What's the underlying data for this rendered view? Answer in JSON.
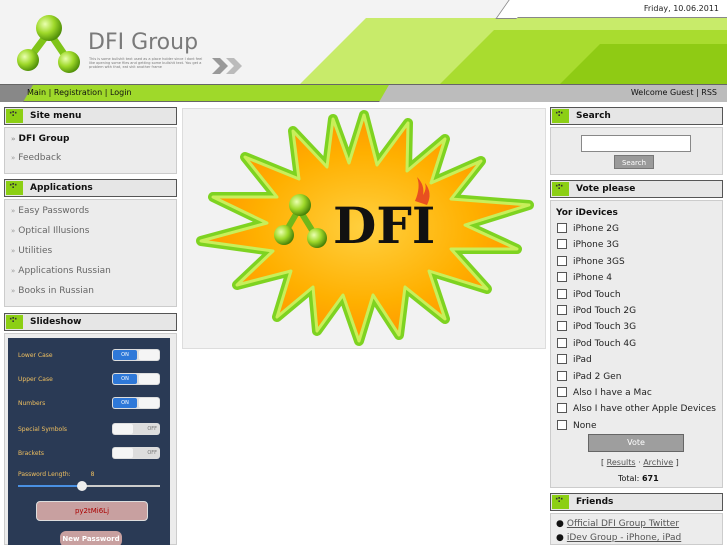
{
  "header": {
    "date": "Friday, 10.06.2011",
    "brand": "DFI Group",
    "tagline": "This is some bullshit text used as a place holder since I dont feel like opening some files and getting some bullshit text. You get a problem with that, eat shit another frame"
  },
  "nav": {
    "main": "Main",
    "registration": "Registration",
    "login": "Login",
    "sep": "|",
    "welcome": "Welcome Guest",
    "rss": "RSS"
  },
  "site_menu": {
    "title": "Site menu",
    "items": [
      "DFI Group",
      "Feedback"
    ]
  },
  "applications": {
    "title": "Applications",
    "items": [
      "Easy Passwords",
      "Optical Illusions",
      "Utilities",
      "Applications Russian",
      "Books in Russian"
    ]
  },
  "slideshow": {
    "title": "Slideshow",
    "rows": [
      "Lower Case",
      "Upper Case",
      "Numbers",
      "Special Symbols",
      "Brackets"
    ],
    "states": [
      "ON",
      "ON",
      "ON",
      "OFF",
      "OFF"
    ],
    "length_label": "Password Length:",
    "length_value": "8",
    "length_fraction": 0.45,
    "generated": "py2tMi6Lj",
    "new_button": "New Password"
  },
  "center_logo": "DFI",
  "search": {
    "title": "Search",
    "button": "Search",
    "placeholder": ""
  },
  "vote": {
    "title": "Vote please",
    "question": "Yor iDevices",
    "options": [
      "iPhone 2G",
      "iPhone 3G",
      "iPhone 3GS",
      "iPhone 4",
      "iPod Touch",
      "iPod Touch 2G",
      "iPod Touch 3G",
      "iPod Touch 4G",
      "iPad",
      "iPad 2 Gen",
      "Also I have a Mac",
      "Also I have other Apple Devices",
      "None"
    ],
    "button": "Vote",
    "results": "Results",
    "archive": "Archive",
    "total_label": "Total:",
    "total_value": "671"
  },
  "friends": {
    "title": "Friends",
    "items": [
      "Official DFI Group Twitter",
      "iDev Group - iPhone, iPad"
    ]
  },
  "colors": {
    "accent_green": "#9fd92a",
    "bullet_green": "#8ccf14"
  }
}
